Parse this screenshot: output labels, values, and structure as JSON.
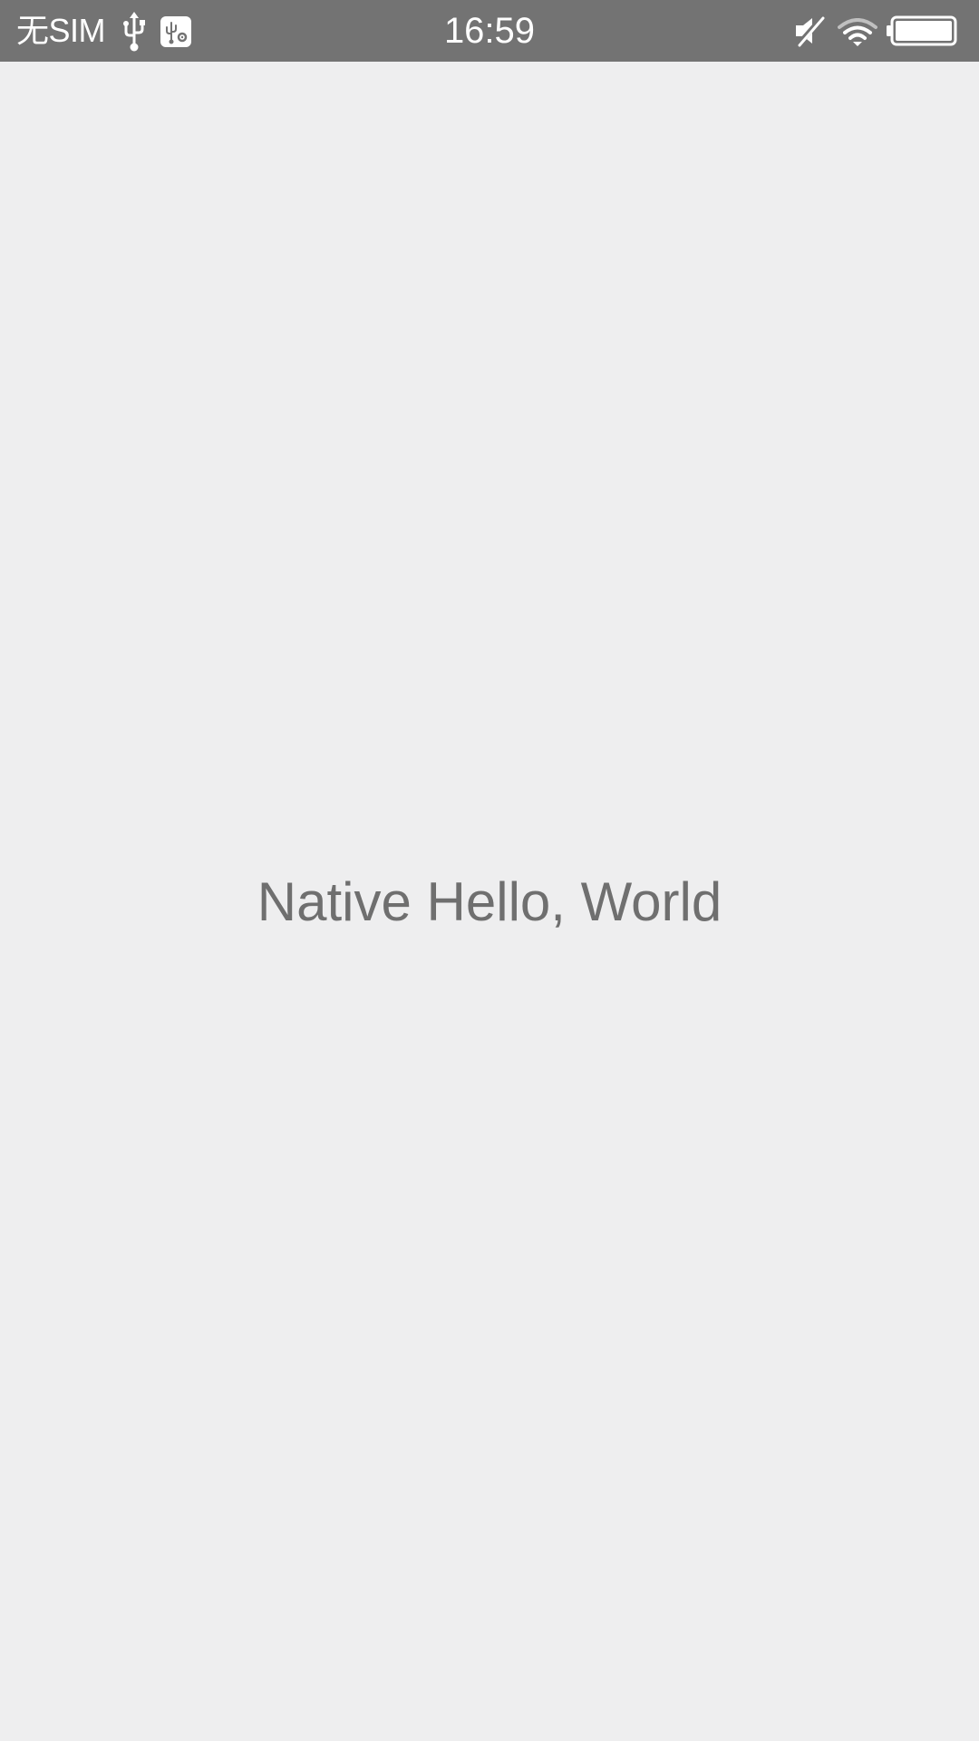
{
  "status_bar": {
    "carrier": "无SIM",
    "time": "16:59",
    "icons": [
      "usb-icon",
      "usb-debugging-icon",
      "mute-icon",
      "wifi-icon",
      "battery-icon"
    ],
    "background": "#737373",
    "foreground": "#ffffff"
  },
  "main": {
    "message": "Native Hello, World",
    "background": "#eeeeef",
    "text_color": "#6f6f6f"
  }
}
